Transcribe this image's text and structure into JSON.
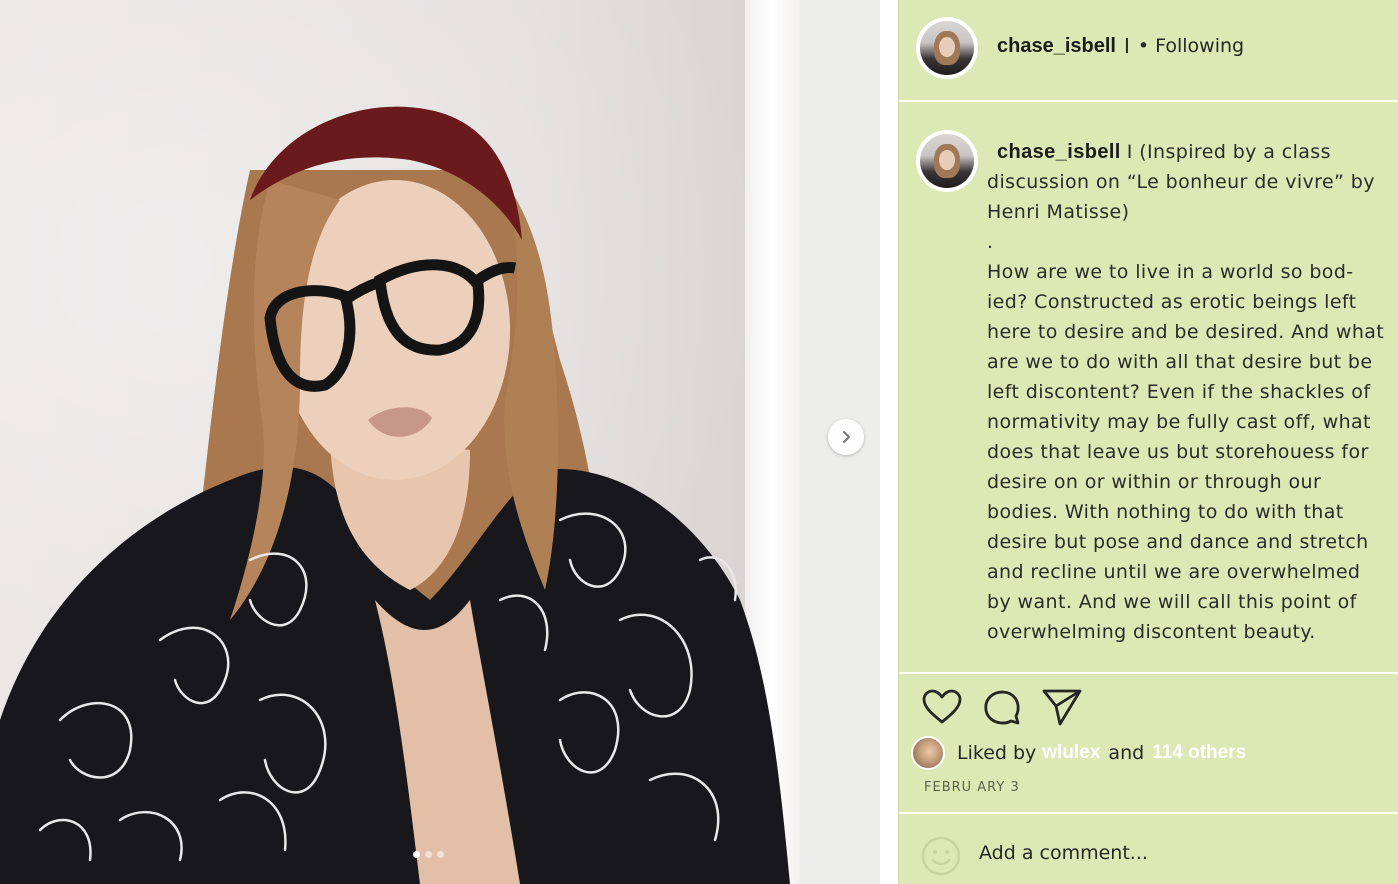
{
  "post": {
    "photo": {
      "carousel_count": 3,
      "carousel_active_index": 0,
      "next_icon": "chevron-right-icon"
    },
    "header": {
      "username": "chase_isbell",
      "separator": "I",
      "follow_status": "• Following"
    },
    "caption": {
      "username": "chase_isbell",
      "separator": "I",
      "lines": [
        "(Inspired by a class discussion on “Le bonheur de vivre” by Henri Matisse)",
        ".",
        "How are we to live in a world so bod-ied? Constructed as erotic beings left here to desire and be desired. And what are we to do with all that desire but be left discontent? Even if the shackles of normativity may be fully cast off, what does that leave us but storehouess for desire on or within or through our bodies. With nothing to do with that desire but pose and dance and stretch and recline until we are overwhelmed by want. And we will call this point of overwhelming discontent beauty."
      ]
    },
    "actions": {
      "like_icon": "heart-icon",
      "comment_icon": "speech-bubble-icon",
      "share_icon": "paper-plane-icon"
    },
    "likes": {
      "prefix": "Liked by",
      "user": "wlulex",
      "connector": "and",
      "others": "114 others"
    },
    "date": "FEBRU ARY 3",
    "comment": {
      "placeholder": "Add a comment...",
      "emoji_icon": "smiley-icon"
    },
    "colors": {
      "panel_background": "#dde9b4",
      "link": "#ffffff"
    }
  }
}
